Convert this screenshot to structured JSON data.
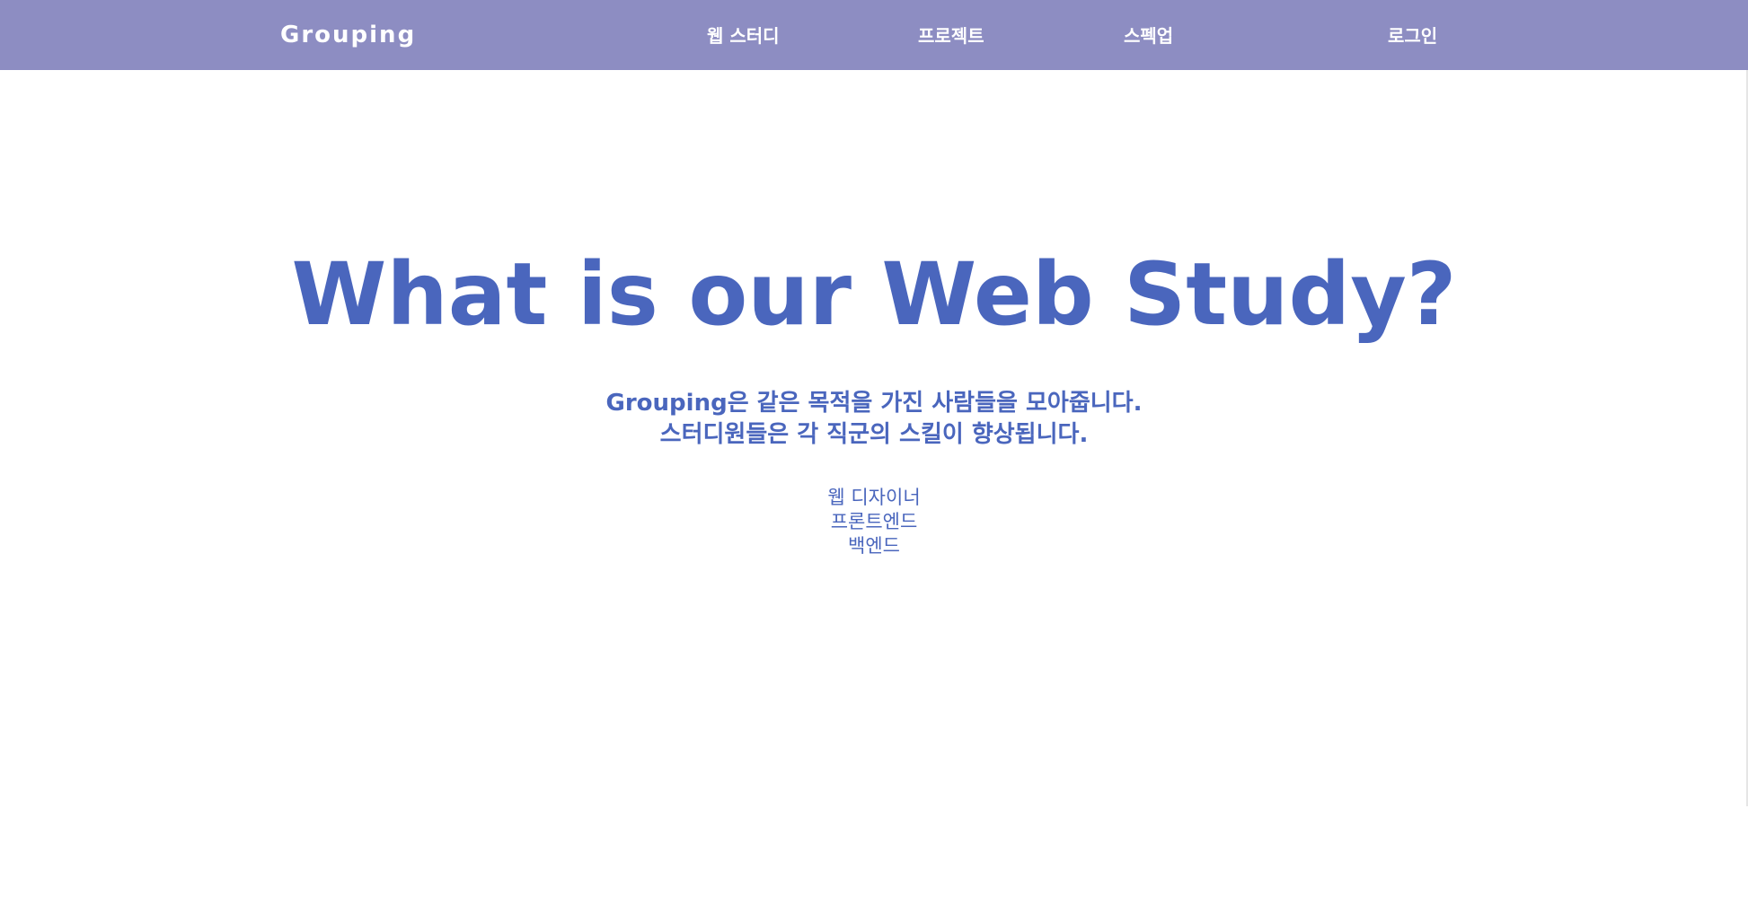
{
  "navbar": {
    "brand": "Grouping",
    "links": [
      {
        "label": "웹 스터디"
      },
      {
        "label": "프로젝트"
      },
      {
        "label": "스펙업"
      }
    ],
    "login_label": "로그인",
    "background_color": "#8d8dc2"
  },
  "hero": {
    "title": "What is our Web Study?",
    "description_lines": [
      "Grouping은 같은 목적을 가진 사람들을 모아줍니다.",
      "스터디원들은 각 직군의 스킬이 향상됩니다."
    ],
    "roles": [
      {
        "label": "웹 디자이너"
      },
      {
        "label": "프론트엔드"
      },
      {
        "label": "백엔드"
      }
    ],
    "text_color": "#4a66bd"
  }
}
